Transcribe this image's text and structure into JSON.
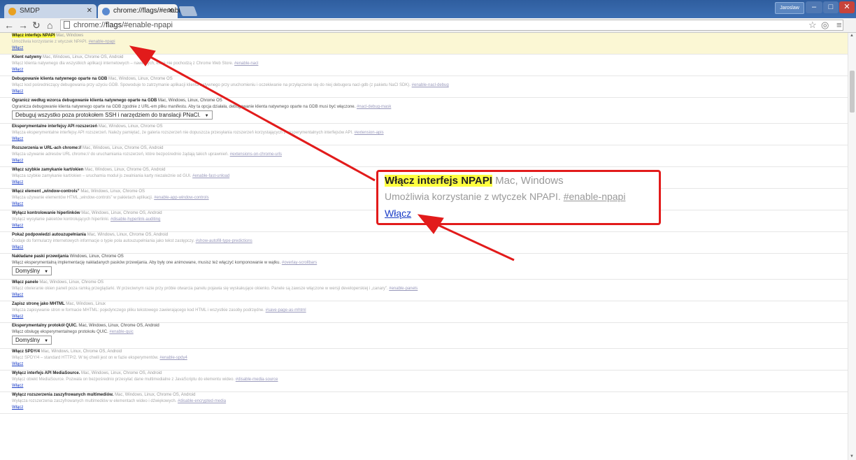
{
  "browser": {
    "tabs": [
      {
        "title": "SMDP",
        "active": false
      },
      {
        "title": "chrome://flags/#enable-n",
        "active": true
      }
    ],
    "user_button": "Jaroslaw",
    "address": {
      "scheme": "chrome://",
      "host": "flags",
      "path": "/#enable-npapi"
    }
  },
  "experiments": [
    {
      "name": "Włącz interfejs NPAPI",
      "platforms": "Mac, Windows",
      "desc": "Umożliwia korzystanie z wtyczek NPAPI.",
      "hash": "#enable-npapi",
      "action": "link",
      "action_label": "Włącz",
      "highlight": true
    },
    {
      "name": "Klient natywny",
      "platforms": "Mac, Windows, Linux, Chrome OS, Android",
      "desc": "Włącz klienta natywnego dla wszystkich aplikacji internetowych – nawet tych, które nie pochodzą z Chrome Web Store.",
      "hash": "#enable-nacl",
      "action": "link",
      "action_label": "Włącz"
    },
    {
      "name": "Debugowanie klienta natywnego oparte na GDB",
      "platforms": "Mac, Windows, Linux, Chrome OS",
      "desc": "Włącz kod pośredniczący debugowania przy użyciu GDB. Spowoduje to zatrzymanie aplikacji klienta natywnego przy uruchomieniu i oczekiwanie na przyłączenie się do niej debugera nacl-gdb (z pakietu NaCl SDK).",
      "hash": "#enable-nacl-debug",
      "action": "link",
      "action_label": "Włącz"
    },
    {
      "name": "Ogranicz według wzorca debugowanie klienta natywnego oparte na GDB",
      "platforms": "Mac, Windows, Linux, Chrome OS",
      "desc": "Ogranicza debugowanie klienta natywnego oparte na GDB zgodnie z URL-em pliku manifestu. Aby ta opcja działała, debugowanie klienta natywnego oparte na GDB musi być włączone.",
      "hash": "#nacl-debug-mask",
      "action": "select",
      "action_label": "Debuguj wszystko poza protokołem SSH i narzędziem do translacji PNaCl.",
      "dark": true
    },
    {
      "name": "Eksperymentalne interfejsy API rozszerzeń",
      "platforms": "Mac, Windows, Linux, Chrome OS",
      "desc": "Włącza eksperymentalne interfejsy API rozszerzeń. Należy pamiętać, że galeria rozszerzeń nie dopuszcza przesyłania rozszerzeń korzystających z eksperymentalnych interfejsów API.",
      "hash": "#extension-apis",
      "action": "link",
      "action_label": "Włącz"
    },
    {
      "name": "Rozszerzenia w URL-ach chrome://",
      "platforms": "Mac, Windows, Linux, Chrome OS, Android",
      "desc": "Włącza używanie adresów URL chrome:// do uruchamiania rozszerzeń, które bezpośrednio żądają takich uprawnień.",
      "hash": "#extensions-on-chrome-urls",
      "action": "link",
      "action_label": "Włącz"
    },
    {
      "name": "Włącz szybkie zamykanie kart/okien",
      "platforms": "Mac, Windows, Linux, Chrome OS, Android",
      "desc": "Włącza szybkie zamykanie kart/okien – uruchamia moduł js zwalniania karty niezależnie od GUI.",
      "hash": "#enable-fast-unload",
      "action": "link",
      "action_label": "Włącz"
    },
    {
      "name": "Włącz element „window-controls”",
      "platforms": "Mac, Windows, Linux, Chrome OS",
      "desc": "Włącza używanie elementów HTML „window-controls” w pakietach aplikacji.",
      "hash": "#enable-app-window-controls",
      "action": "link",
      "action_label": "Włącz"
    },
    {
      "name": "Wyłącz kontrolowanie hiperlinków",
      "platforms": "Mac, Windows, Linux, Chrome OS, Android",
      "desc": "Wyłącz wysyłanie pakietów kontrolujących hiperlinki.",
      "hash": "#disable-hyperlink-auditing",
      "action": "link",
      "action_label": "Włącz"
    },
    {
      "name": "Pokaż podpowiedzi autouzupełniania",
      "platforms": "Mac, Windows, Linux, Chrome OS, Android",
      "desc": "Dodaje do formularzy internetowych informacje o typie pola autouzupełniania jako tekst zastępczy.",
      "hash": "#show-autofill-type-predictions",
      "action": "link",
      "action_label": "Włącz"
    },
    {
      "name": "Nakładane paski przewijania",
      "platforms": "Windows, Linux, Chrome OS",
      "desc": "Włącz eksperymentalną implementację nakładanych pasków przewijania. Aby były one animowane, musisz też włączyć komponowanie w wątku.",
      "hash": "#overlay-scrollbars",
      "action": "select",
      "action_label": "Domyślny",
      "dark": true
    },
    {
      "name": "Włącz panele",
      "platforms": "Mac, Windows, Linux, Chrome OS",
      "desc": "Włącz otwieranie okien paneli poza ramką przeglądarki. W przeciwnym razie przy próbie otwarcia panelu pojawia się wyskakujące okienko. Panele są zawsze włączone w wersji developerskiej i „canary”.",
      "hash": "#enable-panels",
      "action": "link",
      "action_label": "Włącz"
    },
    {
      "name": "Zapisz stronę jako MHTML",
      "platforms": "Mac, Windows, Linux",
      "desc": "Włącza zapisywanie stron w formacie MHTML: pojedynczego pliku tekstowego zawierającego kod HTML i wszystkie zasoby podrzędne.",
      "hash": "#save-page-as-mhtml",
      "action": "link",
      "action_label": "Włącz"
    },
    {
      "name": "Eksperymentalny protokół QUIC.",
      "platforms": "Mac, Windows, Linux, Chrome OS, Android",
      "desc": "Włącz obsługę eksperymentalnego protokołu QUIC.",
      "hash": "#enable-quic",
      "action": "select",
      "action_label": "Domyślny",
      "dark": true
    },
    {
      "name": "Włącz SPDY/4",
      "platforms": "Mac, Windows, Linux, Chrome OS, Android",
      "desc": "Włącz SPDY/4 – standard HTTP/2. W tej chwili jest on w fazie eksperymentów.",
      "hash": "#enable-spdy4",
      "action": "link",
      "action_label": "Włącz"
    },
    {
      "name": "Wyłącz interfejs API MediaSource.",
      "platforms": "Mac, Windows, Linux, Chrome OS, Android",
      "desc": "Wyłącz obiekt MediaSource. Pozwala on bezpośrednio przesyłać dane multimedialne z JavaScriptu do elementu wideo.",
      "hash": "#disable-media-source",
      "action": "link",
      "action_label": "Włącz"
    },
    {
      "name": "Wyłącz rozszerzenia zaszyfrowanych multimediów.",
      "platforms": "Mac, Windows, Linux, Chrome OS, Android",
      "desc": "Wyłącza rozszerzenia zaszyfrowanych multimediów w elementach wideo i dźwiękowych.",
      "hash": "#disable-encrypted-media",
      "action": "link",
      "action_label": "Włącz"
    }
  ],
  "callout": {
    "title": "Włącz interfejs NPAPI",
    "platforms": "Mac, Windows",
    "desc": "Umożliwia korzystanie z wtyczek NPAPI.",
    "hash": "#enable-npapi",
    "link": "Włącz"
  },
  "colors": {
    "annotation": "#e21b1b",
    "highlight": "#ffff40",
    "link": "#1a3cc6"
  }
}
